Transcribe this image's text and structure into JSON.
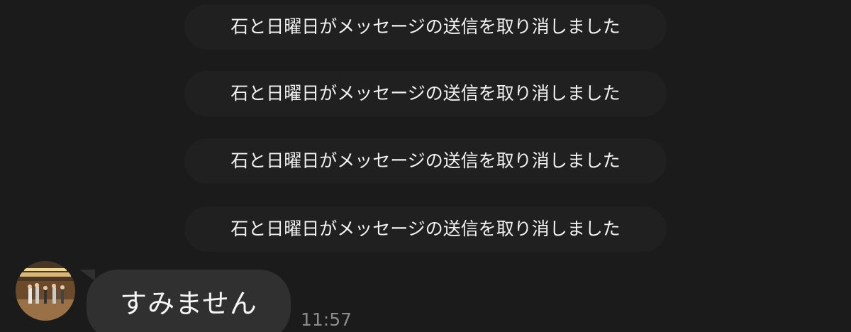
{
  "system_notices": [
    {
      "text": "石と日曜日がメッセージの送信を取り消しました"
    },
    {
      "text": "石と日曜日がメッセージの送信を取り消しました"
    },
    {
      "text": "石と日曜日がメッセージの送信を取り消しました"
    },
    {
      "text": "石と日曜日がメッセージの送信を取り消しました"
    }
  ],
  "message": {
    "text": "すみません",
    "time": "11:57",
    "avatar_icon": "user-avatar-photo"
  },
  "colors": {
    "background": "#1b1b1b",
    "notice_pill": "#202020",
    "bubble": "#303030",
    "text": "#f2f2f2",
    "timestamp": "#8c8c8c"
  }
}
